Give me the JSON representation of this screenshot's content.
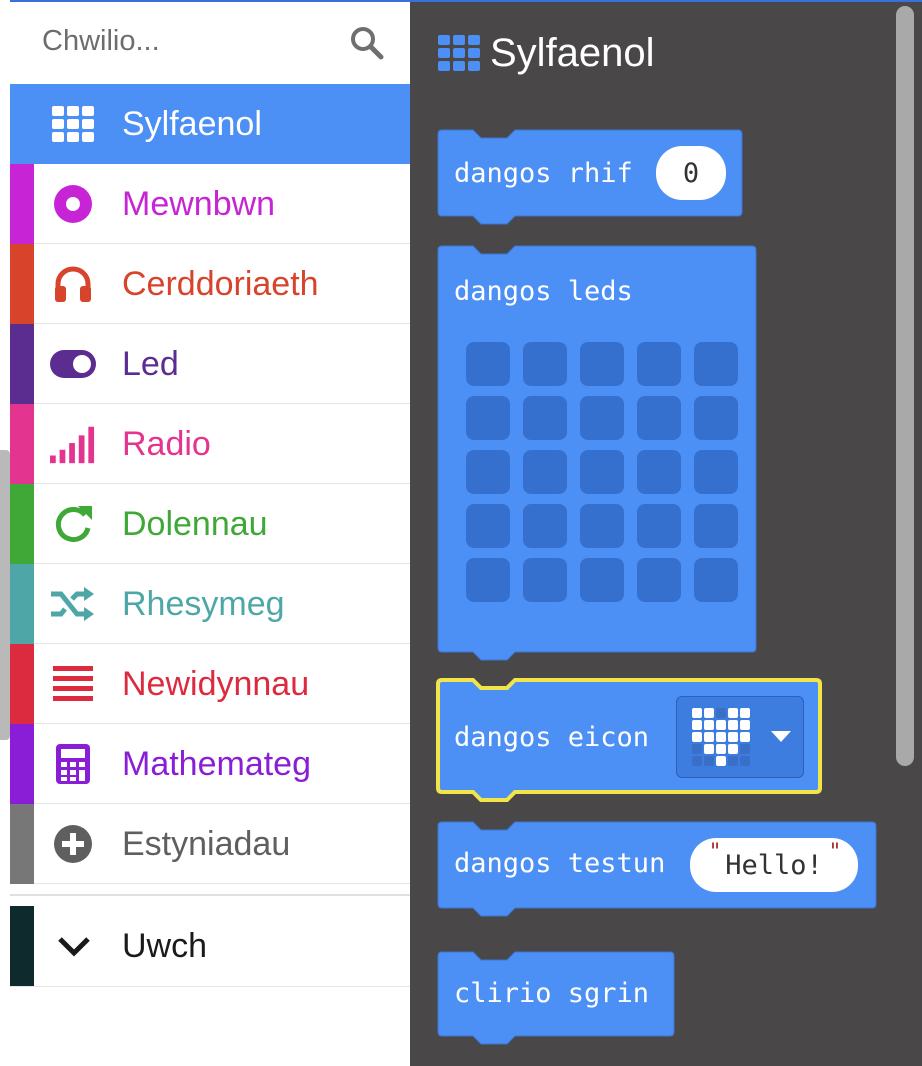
{
  "search": {
    "placeholder": "Chwilio..."
  },
  "categories": [
    {
      "label": "Sylfaenol",
      "icon": "grid-icon",
      "color": "#4c8ff5"
    },
    {
      "label": "Mewnbwn",
      "icon": "radio-button-icon",
      "color": "#c724d6"
    },
    {
      "label": "Cerddoriaeth",
      "icon": "headphones-icon",
      "color": "#d8432b"
    },
    {
      "label": "Led",
      "icon": "toggle-icon",
      "color": "#5b2d91"
    },
    {
      "label": "Radio",
      "icon": "signal-bars-icon",
      "color": "#e3358f"
    },
    {
      "label": "Dolennau",
      "icon": "refresh-icon",
      "color": "#3fa836"
    },
    {
      "label": "Rhesymeg",
      "icon": "shuffle-icon",
      "color": "#4ea7a6"
    },
    {
      "label": "Newidynnau",
      "icon": "list-lines-icon",
      "color": "#dc2b3e"
    },
    {
      "label": "Mathemateg",
      "icon": "calculator-icon",
      "color": "#8a1ed6"
    },
    {
      "label": "Estyniadau",
      "icon": "plus-circle-icon",
      "color": "#777777"
    }
  ],
  "advanced": {
    "label": "Uwch",
    "icon": "chevron-down-icon",
    "color": "#0e2a2d"
  },
  "flyout": {
    "title": "Sylfaenol",
    "blocks": {
      "show_number": {
        "label": "dangos rhif",
        "value": "0"
      },
      "show_leds": {
        "label": "dangos leds"
      },
      "show_icon": {
        "label": "dangos eicon",
        "icon": "heart-icon"
      },
      "show_string": {
        "label": "dangos testun",
        "value": "Hello!"
      },
      "clear_screen": {
        "label": "clirio sgrin"
      }
    }
  }
}
